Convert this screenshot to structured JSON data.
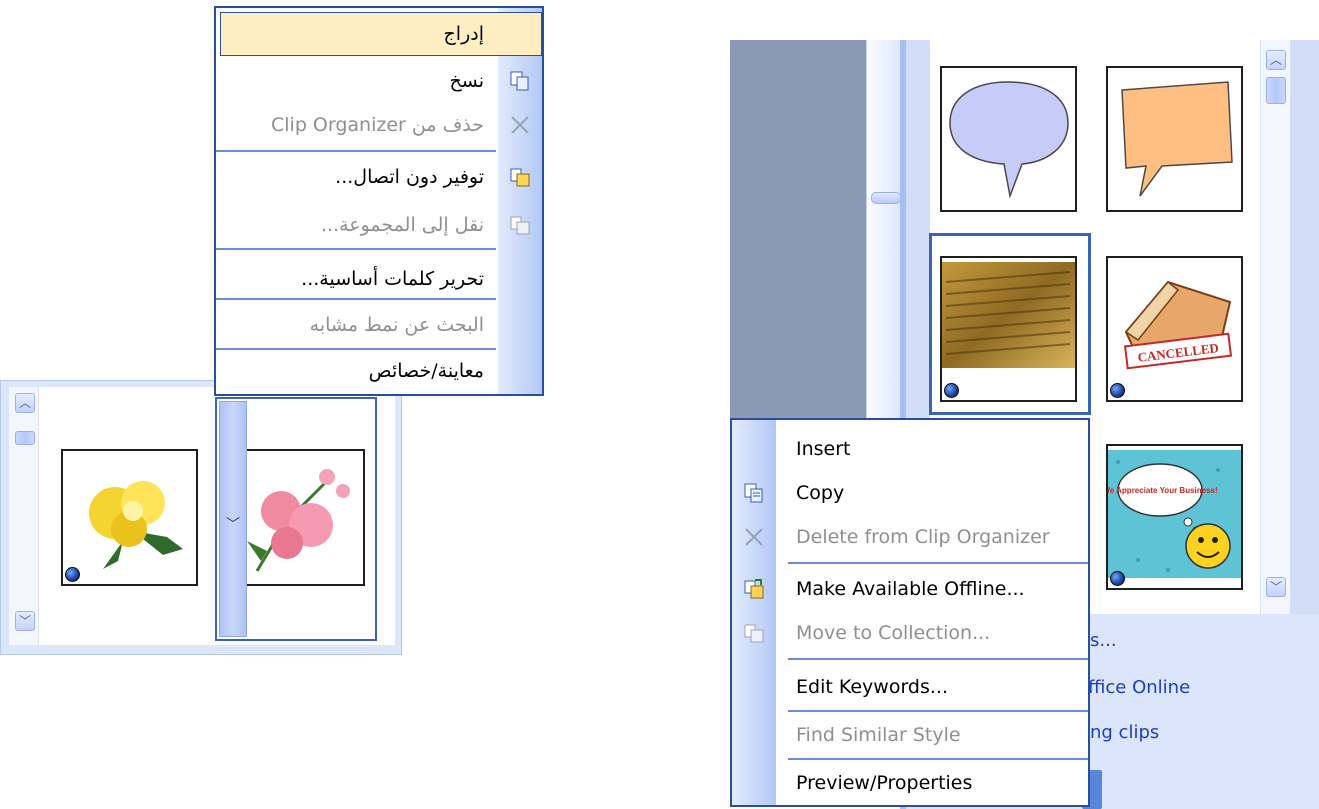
{
  "en_menu": {
    "items": [
      {
        "label": "Insert",
        "disabled": false,
        "icon": ""
      },
      {
        "label": "Copy",
        "disabled": false,
        "icon": "copy-icon"
      },
      {
        "label": "Delete from Clip Organizer",
        "disabled": true,
        "icon": "delete-x-icon"
      },
      {
        "label": "Make Available Offline...",
        "disabled": false,
        "icon": "offline-icon"
      },
      {
        "label": "Move to Collection...",
        "disabled": true,
        "icon": "move-collection-icon"
      },
      {
        "label": "Edit Keywords...",
        "disabled": false,
        "icon": ""
      },
      {
        "label": "Find Similar Style",
        "disabled": true,
        "icon": ""
      },
      {
        "label": "Preview/Properties",
        "disabled": false,
        "icon": ""
      }
    ]
  },
  "ar_menu": {
    "items": [
      {
        "label": "إدراج",
        "disabled": false,
        "highlighted": true,
        "icon": ""
      },
      {
        "label": "نسخ",
        "disabled": false,
        "icon": "copy-icon"
      },
      {
        "label": "حذف من Clip Organizer",
        "disabled": true,
        "icon": "delete-x-icon"
      },
      {
        "label": "توفير دون اتصال...",
        "disabled": false,
        "icon": "offline-icon"
      },
      {
        "label": "نقل إلى المجموعة...",
        "disabled": true,
        "icon": "move-collection-icon"
      },
      {
        "label": "تحرير كلمات أساسية...",
        "disabled": false,
        "icon": ""
      },
      {
        "label": "البحث عن نمط مشابه",
        "disabled": true,
        "icon": ""
      },
      {
        "label": "معاينة/خصائص",
        "disabled": false,
        "icon": ""
      }
    ]
  },
  "task_pane_links": [
    "s...",
    "ffice Online",
    "ng clips"
  ],
  "clips": {
    "cancelled_stamp": "CANCELLED",
    "appreciate_card": "We Appreciate Your Business!"
  },
  "colors": {
    "menu_border": "#2a4f9a",
    "highlight": "#ffeec2",
    "link": "#1c3fbd",
    "selection": "#3b64b5"
  }
}
